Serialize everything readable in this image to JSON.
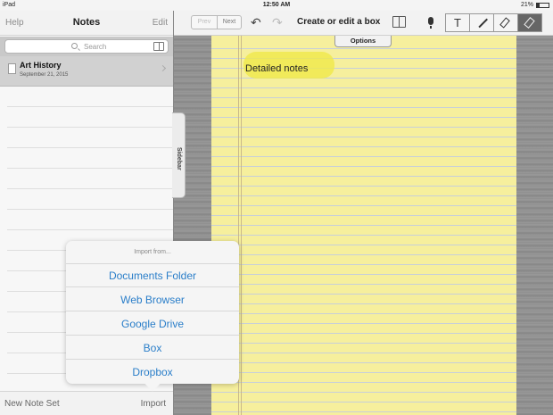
{
  "status_bar": {
    "device": "iPad",
    "time": "12:50 AM",
    "battery": "21%",
    "battery_level": 0.21
  },
  "sidebar": {
    "help_label": "Help",
    "title": "Notes",
    "edit_label": "Edit",
    "search_placeholder": "Search",
    "notes": [
      {
        "title": "Art History",
        "date": "September 21, 2015"
      }
    ],
    "new_note_set_label": "New Note Set",
    "import_label": "Import",
    "sidebar_tab_label": "Sidebar"
  },
  "toolbar": {
    "prev_label": "Prev",
    "next_label": "Next",
    "title": "Create or edit a box",
    "text_tool_label": "T",
    "options_label": "Options"
  },
  "page": {
    "note_text": "Detailed notes"
  },
  "import_popover": {
    "header": "Import from...",
    "items": [
      "Documents Folder",
      "Web Browser",
      "Google Drive",
      "Box",
      "Dropbox"
    ]
  },
  "colors": {
    "accent": "#2a7ec9",
    "paper": "#f6ef9d",
    "highlight": "#f0e84a"
  }
}
